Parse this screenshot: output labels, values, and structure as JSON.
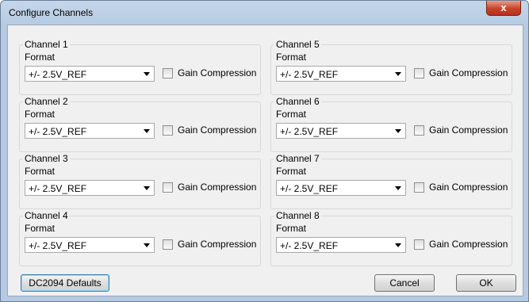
{
  "window": {
    "title": "Configure Channels",
    "close_glyph": "x"
  },
  "format_label": "Format",
  "gain_label": "Gain Compression",
  "channels": [
    {
      "name": "Channel 1",
      "value": "+/- 2.5V_REF",
      "gain": false
    },
    {
      "name": "Channel 2",
      "value": "+/- 2.5V_REF",
      "gain": false
    },
    {
      "name": "Channel 3",
      "value": "+/- 2.5V_REF",
      "gain": false
    },
    {
      "name": "Channel 4",
      "value": "+/- 2.5V_REF",
      "gain": false
    },
    {
      "name": "Channel 5",
      "value": "+/- 2.5V_REF",
      "gain": false
    },
    {
      "name": "Channel 6",
      "value": "+/- 2.5V_REF",
      "gain": false
    },
    {
      "name": "Channel 7",
      "value": "+/- 2.5V_REF",
      "gain": false
    },
    {
      "name": "Channel 8",
      "value": "+/- 2.5V_REF",
      "gain": false
    }
  ],
  "buttons": {
    "defaults": "DC2094 Defaults",
    "cancel": "Cancel",
    "ok": "OK"
  }
}
